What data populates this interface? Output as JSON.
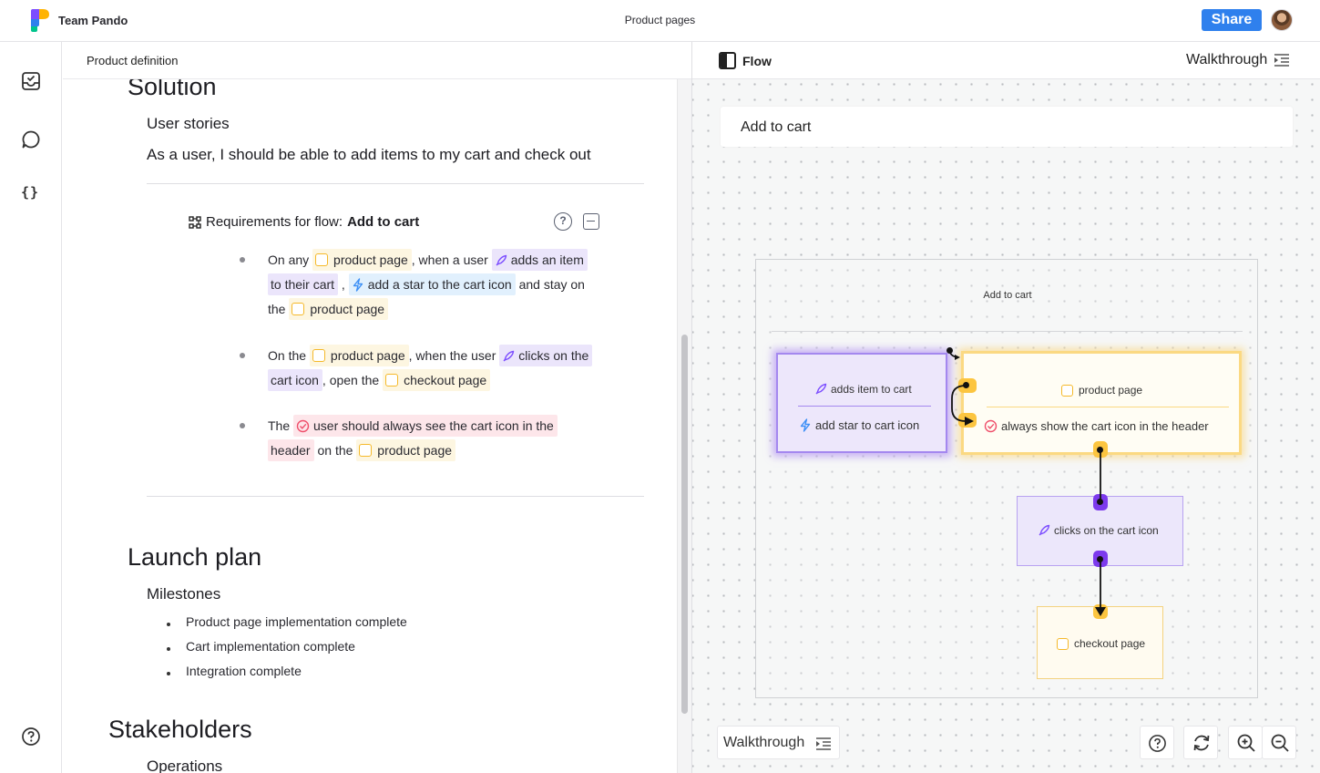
{
  "topbar": {
    "team_name": "Team Pando",
    "document_title": "Product pages",
    "share_label": "Share",
    "brand_color": "#2f80ed"
  },
  "rail": {
    "icons": [
      "inbox-check-icon",
      "comment-icon",
      "braces-icon",
      "help-icon"
    ],
    "braces_glyph": "{}"
  },
  "doc": {
    "header_title": "Product definition",
    "solution_heading": "Solution",
    "user_stories_heading": "User stories",
    "story_text": "As a user, I should be able to add items to my cart and check out",
    "requirements": {
      "title_prefix": "Requirements for flow:",
      "flow_name": "Add to cart",
      "items": [
        {
          "lines": [
            [
              "On any ",
              {
                "kind": "page",
                "text": "product page"
              },
              ", when a user ",
              {
                "kind": "action",
                "text": "adds an item"
              }
            ],
            [
              {
                "kind": "action",
                "text": "to their cart",
                "noicon": true
              },
              " , ",
              {
                "kind": "effect",
                "text": "add a star to the cart icon"
              },
              " and stay on"
            ],
            [
              "the ",
              {
                "kind": "page",
                "text": "product page"
              }
            ]
          ]
        },
        {
          "lines": [
            [
              "On the ",
              {
                "kind": "page",
                "text": "product page"
              },
              ", when the user ",
              {
                "kind": "action",
                "text": "clicks on the"
              }
            ],
            [
              {
                "kind": "action",
                "text": "cart icon",
                "noicon": true
              },
              ", open the ",
              {
                "kind": "page",
                "text": "checkout page"
              }
            ]
          ]
        },
        {
          "lines": [
            [
              "The ",
              {
                "kind": "req",
                "text": "user should always see the cart icon in the"
              }
            ],
            [
              {
                "kind": "req",
                "text": "header",
                "noicon": true
              },
              " on the ",
              {
                "kind": "page",
                "text": "product page"
              }
            ]
          ]
        }
      ]
    },
    "launch_heading": "Launch plan",
    "milestones_heading": "Milestones",
    "milestones": [
      "Product page implementation complete",
      "Cart implementation complete",
      "Integration complete"
    ],
    "stakeholders_heading": "Stakeholders",
    "operations_heading": "Operations"
  },
  "flow": {
    "header_title": "Flow",
    "walkthrough_label": "Walkthrough",
    "flow_name": "Add to cart",
    "frame_label": "Add to cart",
    "nodes": {
      "action_trigger": "adds item to cart",
      "action_effect": "add star to cart icon",
      "page_title": "product page",
      "page_requirement": "always show the cart icon in the header",
      "click_action": "clicks on the cart icon",
      "checkout": "checkout page"
    },
    "colors": {
      "page": "#f5b92a",
      "action": "#8b5cf6",
      "effect": "#3b8ff6",
      "requirement": "#ef4f6b"
    },
    "toolbar": {
      "bottom_walkthrough_label": "Walkthrough",
      "tools": [
        "help-icon",
        "refresh-icon",
        "zoom-in-icon",
        "zoom-out-icon"
      ]
    }
  }
}
